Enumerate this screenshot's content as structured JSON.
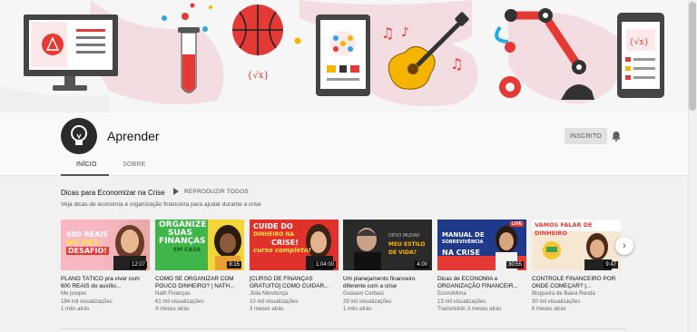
{
  "channel": {
    "name": "Aprender",
    "subscribe_label": "INSCRITO"
  },
  "tabs": [
    {
      "label": "INÍCIO",
      "active": true
    },
    {
      "label": "SOBRE",
      "active": false
    }
  ],
  "shelf": {
    "title": "Dicas para Economizar na Crise",
    "play_all_label": "REPRODUZIR TODOS",
    "description": "Veja dicas de economia e organização financeira para ajudar durante a crise"
  },
  "videos": [
    {
      "title": "PLANO TÁTICO pra viver com 600 REAIS do auxílio...",
      "channel": "Me poupe!",
      "views": "184 mil visualizações",
      "age": "1 mês atrás",
      "duration": "12:07",
      "thumb_text": [
        "600 REAIS",
        "NO MÊS:",
        "DESAFIO!"
      ]
    },
    {
      "title": "COMO SE ORGANIZAR COM POUCO DINHEIRO? | NATH...",
      "channel": "Nath Finanças",
      "views": "61 mil visualizações",
      "age": "4 meses atrás",
      "duration": "8:15",
      "thumb_text": [
        "ORGANIZE",
        "SUAS",
        "FINANÇAS",
        "EM CASA"
      ]
    },
    {
      "title": "[CURSO DE FINANÇAS GRATUITO] COMO CUIDAR...",
      "channel": "Júlia Mendonça",
      "views": "10 mil visualizações",
      "age": "3 meses atrás",
      "duration": "1:04:00",
      "thumb_text": [
        "CUIDE DO",
        "DINHEIRO NA",
        "CRISE!",
        "curso completo!"
      ]
    },
    {
      "title": "Um planejamento financeiro diferente com a crise",
      "channel": "Gustavo Cerbasi",
      "views": "29 mil visualizações",
      "age": "1 mês atrás",
      "duration": "4:00",
      "thumb_text": [
        "DEVO MUDAR",
        "MEU ESTILO",
        "DE VIDA?"
      ]
    },
    {
      "title": "Dicas de ECONOMIA e ORGANIZAÇÃO FINANCEIR...",
      "channel": "EconoMima",
      "views": "13 mil visualizações",
      "age": "Transmitido 3 meses atrás",
      "duration": "30:55",
      "thumb_text": [
        "MANUAL DE",
        "SOBREVIVÊNCIA",
        "NA CRISE",
        "LIVE"
      ]
    },
    {
      "title": "CONTROLE FINANCEIRO POR ONDE COMEÇAR? |...",
      "channel": "Blogueira de Baixa Renda",
      "views": "30 mil visualizações",
      "age": "6 meses atrás",
      "duration": "9:47",
      "thumb_text": [
        "VAMOS FALAR DE DINHEIRO"
      ]
    }
  ],
  "colors": {
    "accent_red": "#e53935",
    "banner_blob": "#f3dde1",
    "dark": "#333333",
    "gold": "#f4b400"
  }
}
